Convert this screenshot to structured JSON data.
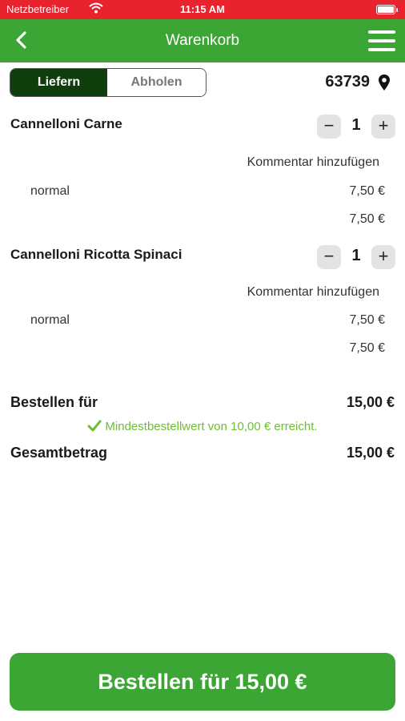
{
  "status_bar": {
    "carrier": "Netzbetreiber",
    "time": "11:15 AM"
  },
  "nav": {
    "title": "Warenkorb"
  },
  "delivery_toggle": {
    "deliver": "Liefern",
    "pickup": "Abholen",
    "selected": "Liefern"
  },
  "location": {
    "zip": "63739"
  },
  "cart": {
    "items": [
      {
        "name": "Cannelloni Carne",
        "quantity": "1",
        "minus": "−",
        "plus": "+",
        "comment_label": "Kommentar hinzufügen",
        "option": "normal",
        "option_price": "7,50 €",
        "item_total": "7,50 €"
      },
      {
        "name": "Cannelloni Ricotta Spinaci",
        "quantity": "1",
        "minus": "−",
        "plus": "+",
        "comment_label": "Kommentar hinzufügen",
        "option": "normal",
        "option_price": "7,50 €",
        "item_total": "7,50 €"
      }
    ]
  },
  "summary": {
    "order_for_label": "Bestellen für",
    "order_for_value": "15,00 €",
    "min_order_note": "Mindestbestellwert von 10,00 € erreicht.",
    "total_label": "Gesamtbetrag",
    "total_value": "15,00 €"
  },
  "order_button": {
    "label": "Bestellen für 15,00 €"
  },
  "colors": {
    "status_red": "#e8232d",
    "brand_green": "#3ca634",
    "dark_green": "#0f3d0c",
    "success_green": "#6cbf33"
  }
}
